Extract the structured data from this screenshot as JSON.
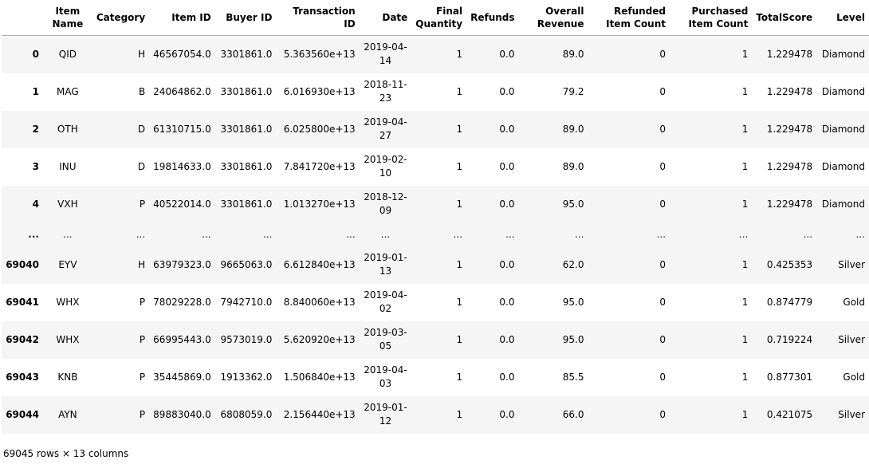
{
  "table": {
    "columns": [
      "Item Name",
      "Category",
      "Item ID",
      "Buyer ID",
      "Transaction ID",
      "Date",
      "Final Quantity",
      "Refunds",
      "Overall Revenue",
      "Refunded Item Count",
      "Purchased Item Count",
      "TotalScore",
      "Level"
    ],
    "ellipsis": "...",
    "rows_top": [
      {
        "index": "0",
        "cells": [
          "QID",
          "H",
          "46567054.0",
          "3301861.0",
          "5.363560e+13",
          "2019-04-14",
          "1",
          "0.0",
          "89.0",
          "0",
          "1",
          "1.229478",
          "Diamond"
        ]
      },
      {
        "index": "1",
        "cells": [
          "MAG",
          "B",
          "24064862.0",
          "3301861.0",
          "6.016930e+13",
          "2018-11-23",
          "1",
          "0.0",
          "79.2",
          "0",
          "1",
          "1.229478",
          "Diamond"
        ]
      },
      {
        "index": "2",
        "cells": [
          "OTH",
          "D",
          "61310715.0",
          "3301861.0",
          "6.025800e+13",
          "2019-04-27",
          "1",
          "0.0",
          "89.0",
          "0",
          "1",
          "1.229478",
          "Diamond"
        ]
      },
      {
        "index": "3",
        "cells": [
          "INU",
          "D",
          "19814633.0",
          "3301861.0",
          "7.841720e+13",
          "2019-02-10",
          "1",
          "0.0",
          "89.0",
          "0",
          "1",
          "1.229478",
          "Diamond"
        ]
      },
      {
        "index": "4",
        "cells": [
          "VXH",
          "P",
          "40522014.0",
          "3301861.0",
          "1.013270e+13",
          "2018-12-09",
          "1",
          "0.0",
          "95.0",
          "0",
          "1",
          "1.229478",
          "Diamond"
        ]
      }
    ],
    "rows_bottom": [
      {
        "index": "69040",
        "cells": [
          "EYV",
          "H",
          "63979323.0",
          "9665063.0",
          "6.612840e+13",
          "2019-01-13",
          "1",
          "0.0",
          "62.0",
          "0",
          "1",
          "0.425353",
          "Silver"
        ]
      },
      {
        "index": "69041",
        "cells": [
          "WHX",
          "P",
          "78029228.0",
          "7942710.0",
          "8.840060e+13",
          "2019-04-02",
          "1",
          "0.0",
          "95.0",
          "0",
          "1",
          "0.874779",
          "Gold"
        ]
      },
      {
        "index": "69042",
        "cells": [
          "WHX",
          "P",
          "66995443.0",
          "9573019.0",
          "5.620920e+13",
          "2019-03-05",
          "1",
          "0.0",
          "95.0",
          "0",
          "1",
          "0.719224",
          "Silver"
        ]
      },
      {
        "index": "69043",
        "cells": [
          "KNB",
          "P",
          "35445869.0",
          "1913362.0",
          "1.506840e+13",
          "2019-04-03",
          "1",
          "0.0",
          "85.5",
          "0",
          "1",
          "0.877301",
          "Gold"
        ]
      },
      {
        "index": "69044",
        "cells": [
          "AYN",
          "P",
          "89883040.0",
          "6808059.0",
          "2.156440e+13",
          "2019-01-12",
          "1",
          "0.0",
          "66.0",
          "0",
          "1",
          "0.421075",
          "Silver"
        ]
      }
    ]
  },
  "summary": "69045 rows × 13 columns",
  "colors": {
    "stripe": "#f5f5f5",
    "header_rule": "#b0b0b0"
  }
}
